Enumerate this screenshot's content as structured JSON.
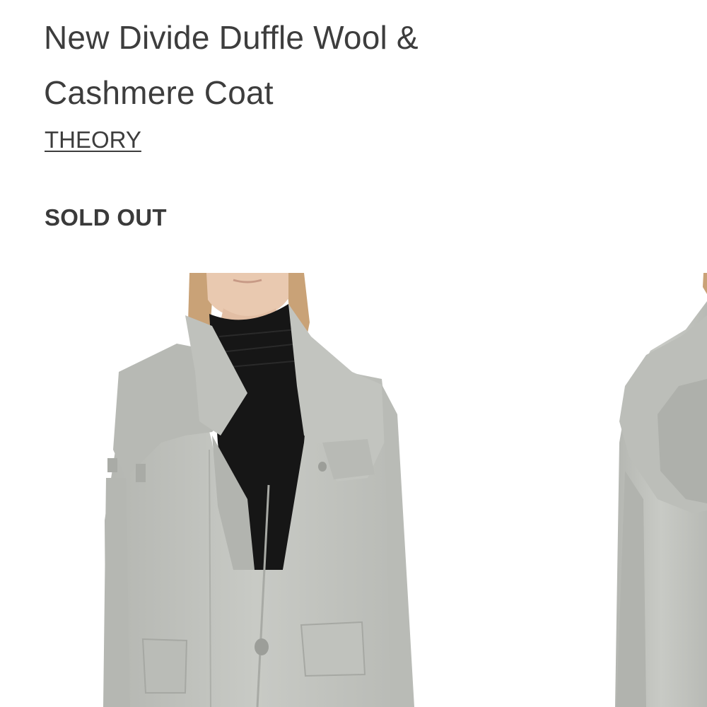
{
  "product": {
    "title_line1": "New Divide Duffle Wool &",
    "title_line2": "Cashmere Coat",
    "brand": "THEORY",
    "availability": "SOLD OUT"
  },
  "gallery": {
    "images": [
      {
        "subject": "model-front-view",
        "product_color": "#c4c6c1"
      },
      {
        "subject": "model-back-view",
        "product_color": "#c4c6c1"
      }
    ]
  },
  "colors": {
    "text": "#3d3d3d",
    "background": "#ffffff",
    "coat_gray": "#c4c6c1",
    "sweater_black": "#161616"
  }
}
